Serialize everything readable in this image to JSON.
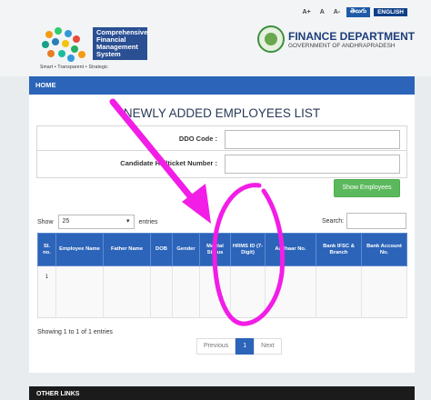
{
  "accessibility": {
    "font_sizes": [
      "A+",
      "A",
      "A-"
    ],
    "lang_telugu": "తెలుగు",
    "lang_english": "ENGLISH"
  },
  "header": {
    "cfms_title": "Comprehensive Financial Management System",
    "cfms_tagline": "Smart • Transparent • Strategic",
    "dept_title": "FINANCE DEPARTMENT",
    "dept_subtitle": "GOVERNMENT OF ANDHRAPRADESH"
  },
  "nav": {
    "home": "HOME"
  },
  "page": {
    "title": "NEWLY ADDED EMPLOYEES LIST",
    "ddo_label": "DDO Code :",
    "ddo_value": "",
    "candidate_label": "Candidate Hallticket Number :",
    "candidate_value": "",
    "show_button": "Show Employees"
  },
  "list_controls": {
    "show_label": "Show",
    "page_size": "25",
    "entries_label": "entries",
    "search_label": "Search:"
  },
  "table": {
    "headers": [
      "Sl. no.",
      "Employee Name",
      "Father Name",
      "DOB",
      "Gender",
      "Marital Status",
      "HRMS ID (7-Digit)",
      "Aadhaar No.",
      "Bank IFSC & Branch",
      "Bank Account No."
    ],
    "rows": [
      [
        "1",
        "",
        "",
        "",
        "",
        "",
        "",
        "",
        "",
        ""
      ]
    ]
  },
  "footer_info": {
    "showing": "Showing 1 to 1 of 1 entries",
    "prev": "Previous",
    "page": "1",
    "next": "Next"
  },
  "bottom_bar": {
    "label": "OTHER LINKS"
  },
  "colors": {
    "primary": "#2c64b9",
    "success": "#5cb85c",
    "annotation": "#f21de6"
  }
}
